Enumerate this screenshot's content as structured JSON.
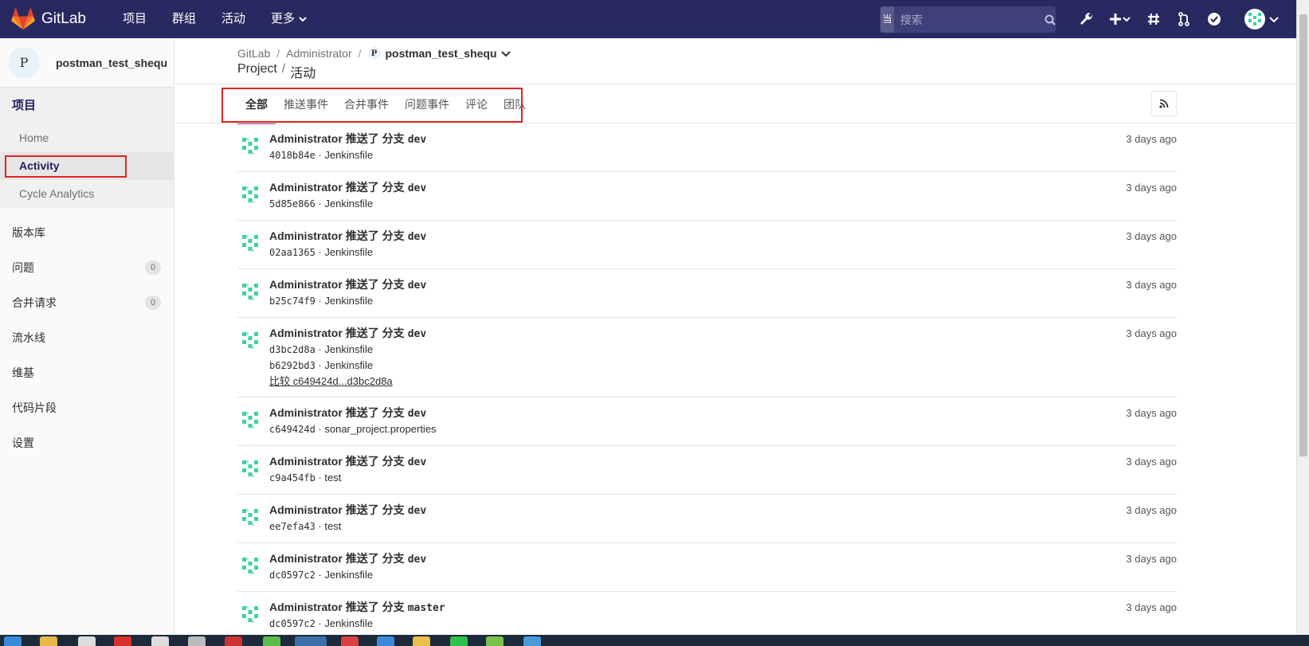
{
  "topbar": {
    "brand": "GitLab",
    "nav": [
      "项目",
      "群组",
      "活动",
      "更多"
    ],
    "search_scope": "当前项目",
    "search_placeholder": "搜索"
  },
  "sidebar": {
    "project_initial": "P",
    "project_name": "postman_test_shequ",
    "section": "项目",
    "sub_items": [
      "Home",
      "Activity",
      "Cycle Analytics"
    ],
    "items": [
      {
        "label": "版本库"
      },
      {
        "label": "问题",
        "count": "0"
      },
      {
        "label": "合并请求",
        "count": "0"
      },
      {
        "label": "流水线"
      },
      {
        "label": "维基"
      },
      {
        "label": "代码片段"
      },
      {
        "label": "设置"
      }
    ]
  },
  "breadcrumb": {
    "root": "GitLab",
    "group": "Administrator",
    "project_initial": "P",
    "project": "postman_test_shequ"
  },
  "page_title": {
    "part1": "Project",
    "part2": "活动"
  },
  "tabs": [
    "全部",
    "推送事件",
    "合并事件",
    "问题事件",
    "评论",
    "团队"
  ],
  "events": [
    {
      "author": "Administrator",
      "action": "推送了 分支",
      "branch": "dev",
      "commits": [
        {
          "sha": "4018b84e",
          "msg": "Jenkinsfile"
        }
      ],
      "time": "3 days ago"
    },
    {
      "author": "Administrator",
      "action": "推送了 分支",
      "branch": "dev",
      "commits": [
        {
          "sha": "5d85e866",
          "msg": "Jenkinsfile"
        }
      ],
      "time": "3 days ago"
    },
    {
      "author": "Administrator",
      "action": "推送了 分支",
      "branch": "dev",
      "commits": [
        {
          "sha": "02aa1365",
          "msg": "Jenkinsfile"
        }
      ],
      "time": "3 days ago"
    },
    {
      "author": "Administrator",
      "action": "推送了 分支",
      "branch": "dev",
      "commits": [
        {
          "sha": "b25c74f9",
          "msg": "Jenkinsfile"
        }
      ],
      "time": "3 days ago"
    },
    {
      "author": "Administrator",
      "action": "推送了 分支",
      "branch": "dev",
      "commits": [
        {
          "sha": "d3bc2d8a",
          "msg": "Jenkinsfile"
        },
        {
          "sha": "b6292bd3",
          "msg": "Jenkinsfile"
        }
      ],
      "compare": "比较 c649424d...d3bc2d8a",
      "time": "3 days ago"
    },
    {
      "author": "Administrator",
      "action": "推送了 分支",
      "branch": "dev",
      "commits": [
        {
          "sha": "c649424d",
          "msg": "sonar_project.properties"
        }
      ],
      "time": "3 days ago"
    },
    {
      "author": "Administrator",
      "action": "推送了 分支",
      "branch": "dev",
      "commits": [
        {
          "sha": "c9a454fb",
          "msg": "test"
        }
      ],
      "time": "3 days ago"
    },
    {
      "author": "Administrator",
      "action": "推送了 分支",
      "branch": "dev",
      "commits": [
        {
          "sha": "ee7efa43",
          "msg": "test"
        }
      ],
      "time": "3 days ago"
    },
    {
      "author": "Administrator",
      "action": "推送了 分支",
      "branch": "dev",
      "commits": [
        {
          "sha": "dc0597c2",
          "msg": "Jenkinsfile"
        }
      ],
      "time": "3 days ago"
    },
    {
      "author": "Administrator",
      "action": "推送了 分支",
      "branch": "master",
      "commits": [
        {
          "sha": "dc0597c2",
          "msg": "Jenkinsfile"
        }
      ],
      "time": "3 days ago"
    }
  ],
  "colors": {
    "navbar": "#292961",
    "accent": "#7a4ca8",
    "highlight_box": "#e52222",
    "avatar_identicon": "#3fd1a1"
  },
  "icons": {
    "rss": "rss-icon",
    "wrench": "wrench-icon",
    "plus": "plus-icon",
    "hash": "hash-icon",
    "merge": "merge-request-icon",
    "todo": "todo-check-icon",
    "search": "search-icon"
  }
}
